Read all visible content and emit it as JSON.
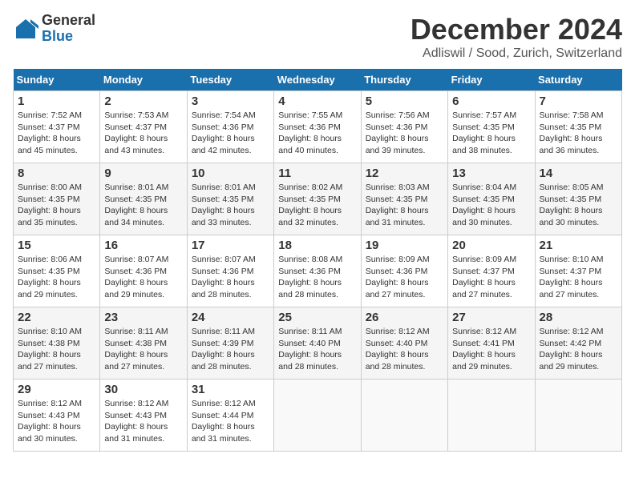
{
  "logo": {
    "general": "General",
    "blue": "Blue"
  },
  "header": {
    "month": "December 2024",
    "location": "Adliswil / Sood, Zurich, Switzerland"
  },
  "days_of_week": [
    "Sunday",
    "Monday",
    "Tuesday",
    "Wednesday",
    "Thursday",
    "Friday",
    "Saturday"
  ],
  "weeks": [
    [
      {
        "day": "1",
        "sunrise": "7:52 AM",
        "sunset": "4:37 PM",
        "daylight": "8 hours and 45 minutes."
      },
      {
        "day": "2",
        "sunrise": "7:53 AM",
        "sunset": "4:37 PM",
        "daylight": "8 hours and 43 minutes."
      },
      {
        "day": "3",
        "sunrise": "7:54 AM",
        "sunset": "4:36 PM",
        "daylight": "8 hours and 42 minutes."
      },
      {
        "day": "4",
        "sunrise": "7:55 AM",
        "sunset": "4:36 PM",
        "daylight": "8 hours and 40 minutes."
      },
      {
        "day": "5",
        "sunrise": "7:56 AM",
        "sunset": "4:36 PM",
        "daylight": "8 hours and 39 minutes."
      },
      {
        "day": "6",
        "sunrise": "7:57 AM",
        "sunset": "4:35 PM",
        "daylight": "8 hours and 38 minutes."
      },
      {
        "day": "7",
        "sunrise": "7:58 AM",
        "sunset": "4:35 PM",
        "daylight": "8 hours and 36 minutes."
      }
    ],
    [
      {
        "day": "8",
        "sunrise": "8:00 AM",
        "sunset": "4:35 PM",
        "daylight": "8 hours and 35 minutes."
      },
      {
        "day": "9",
        "sunrise": "8:01 AM",
        "sunset": "4:35 PM",
        "daylight": "8 hours and 34 minutes."
      },
      {
        "day": "10",
        "sunrise": "8:01 AM",
        "sunset": "4:35 PM",
        "daylight": "8 hours and 33 minutes."
      },
      {
        "day": "11",
        "sunrise": "8:02 AM",
        "sunset": "4:35 PM",
        "daylight": "8 hours and 32 minutes."
      },
      {
        "day": "12",
        "sunrise": "8:03 AM",
        "sunset": "4:35 PM",
        "daylight": "8 hours and 31 minutes."
      },
      {
        "day": "13",
        "sunrise": "8:04 AM",
        "sunset": "4:35 PM",
        "daylight": "8 hours and 30 minutes."
      },
      {
        "day": "14",
        "sunrise": "8:05 AM",
        "sunset": "4:35 PM",
        "daylight": "8 hours and 30 minutes."
      }
    ],
    [
      {
        "day": "15",
        "sunrise": "8:06 AM",
        "sunset": "4:35 PM",
        "daylight": "8 hours and 29 minutes."
      },
      {
        "day": "16",
        "sunrise": "8:07 AM",
        "sunset": "4:36 PM",
        "daylight": "8 hours and 29 minutes."
      },
      {
        "day": "17",
        "sunrise": "8:07 AM",
        "sunset": "4:36 PM",
        "daylight": "8 hours and 28 minutes."
      },
      {
        "day": "18",
        "sunrise": "8:08 AM",
        "sunset": "4:36 PM",
        "daylight": "8 hours and 28 minutes."
      },
      {
        "day": "19",
        "sunrise": "8:09 AM",
        "sunset": "4:36 PM",
        "daylight": "8 hours and 27 minutes."
      },
      {
        "day": "20",
        "sunrise": "8:09 AM",
        "sunset": "4:37 PM",
        "daylight": "8 hours and 27 minutes."
      },
      {
        "day": "21",
        "sunrise": "8:10 AM",
        "sunset": "4:37 PM",
        "daylight": "8 hours and 27 minutes."
      }
    ],
    [
      {
        "day": "22",
        "sunrise": "8:10 AM",
        "sunset": "4:38 PM",
        "daylight": "8 hours and 27 minutes."
      },
      {
        "day": "23",
        "sunrise": "8:11 AM",
        "sunset": "4:38 PM",
        "daylight": "8 hours and 27 minutes."
      },
      {
        "day": "24",
        "sunrise": "8:11 AM",
        "sunset": "4:39 PM",
        "daylight": "8 hours and 28 minutes."
      },
      {
        "day": "25",
        "sunrise": "8:11 AM",
        "sunset": "4:40 PM",
        "daylight": "8 hours and 28 minutes."
      },
      {
        "day": "26",
        "sunrise": "8:12 AM",
        "sunset": "4:40 PM",
        "daylight": "8 hours and 28 minutes."
      },
      {
        "day": "27",
        "sunrise": "8:12 AM",
        "sunset": "4:41 PM",
        "daylight": "8 hours and 29 minutes."
      },
      {
        "day": "28",
        "sunrise": "8:12 AM",
        "sunset": "4:42 PM",
        "daylight": "8 hours and 29 minutes."
      }
    ],
    [
      {
        "day": "29",
        "sunrise": "8:12 AM",
        "sunset": "4:43 PM",
        "daylight": "8 hours and 30 minutes."
      },
      {
        "day": "30",
        "sunrise": "8:12 AM",
        "sunset": "4:43 PM",
        "daylight": "8 hours and 31 minutes."
      },
      {
        "day": "31",
        "sunrise": "8:12 AM",
        "sunset": "4:44 PM",
        "daylight": "8 hours and 31 minutes."
      },
      null,
      null,
      null,
      null
    ]
  ]
}
